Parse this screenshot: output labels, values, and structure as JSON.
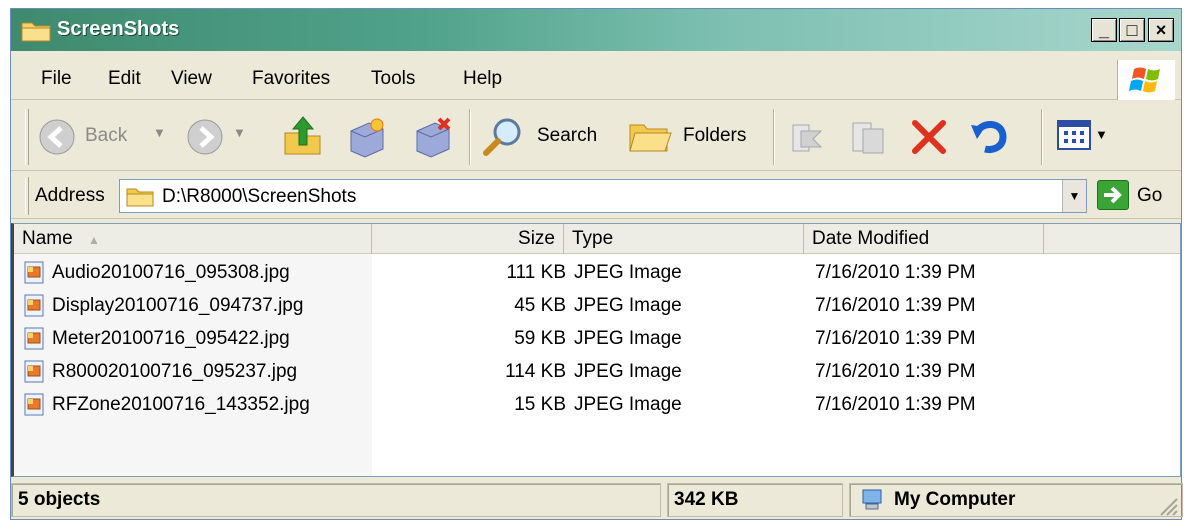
{
  "window": {
    "title": "ScreenShots",
    "title_icon": "folder-icon",
    "min_glyph": "_",
    "max_glyph": "□",
    "close_glyph": "×"
  },
  "menubar": {
    "items": [
      "File",
      "Edit",
      "View",
      "Favorites",
      "Tools",
      "Help"
    ]
  },
  "toolbar": {
    "back_label": "Back",
    "search_label": "Search",
    "folders_label": "Folders",
    "icons": [
      "back-icon",
      "forward-icon",
      "up-folder-icon",
      "copy-to-icon",
      "move-to-icon",
      "search-icon",
      "folders-icon",
      "cut-icon",
      "paste-icon",
      "delete-icon",
      "undo-icon",
      "views-icon"
    ]
  },
  "address": {
    "label": "Address",
    "value": "D:\\R8000\\ScreenShots",
    "go_label": "Go"
  },
  "list": {
    "columns": [
      "Name",
      "Size",
      "Type",
      "Date Modified"
    ],
    "sorted_column": "Name",
    "rows": [
      {
        "name": "Audio20100716_095308.jpg",
        "size": "111 KB",
        "type": "JPEG Image",
        "date": "7/16/2010 1:39 PM"
      },
      {
        "name": "Display20100716_094737.jpg",
        "size": "45 KB",
        "type": "JPEG Image",
        "date": "7/16/2010 1:39 PM"
      },
      {
        "name": "Meter20100716_095422.jpg",
        "size": "59 KB",
        "type": "JPEG Image",
        "date": "7/16/2010 1:39 PM"
      },
      {
        "name": "R800020100716_095237.jpg",
        "size": "114 KB",
        "type": "JPEG Image",
        "date": "7/16/2010 1:39 PM"
      },
      {
        "name": "RFZone20100716_143352.jpg",
        "size": "15 KB",
        "type": "JPEG Image",
        "date": "7/16/2010 1:39 PM"
      }
    ]
  },
  "status": {
    "objects": "5 objects",
    "size": "342 KB",
    "zone": "My Computer"
  },
  "colors": {
    "titlebar_start": "#3f8a6f",
    "titlebar_end": "#a8d6cd",
    "chrome": "#ece9d8",
    "delete_red": "#e0301e",
    "undo_blue": "#1a5fd0",
    "go_green": "#3aa535"
  }
}
